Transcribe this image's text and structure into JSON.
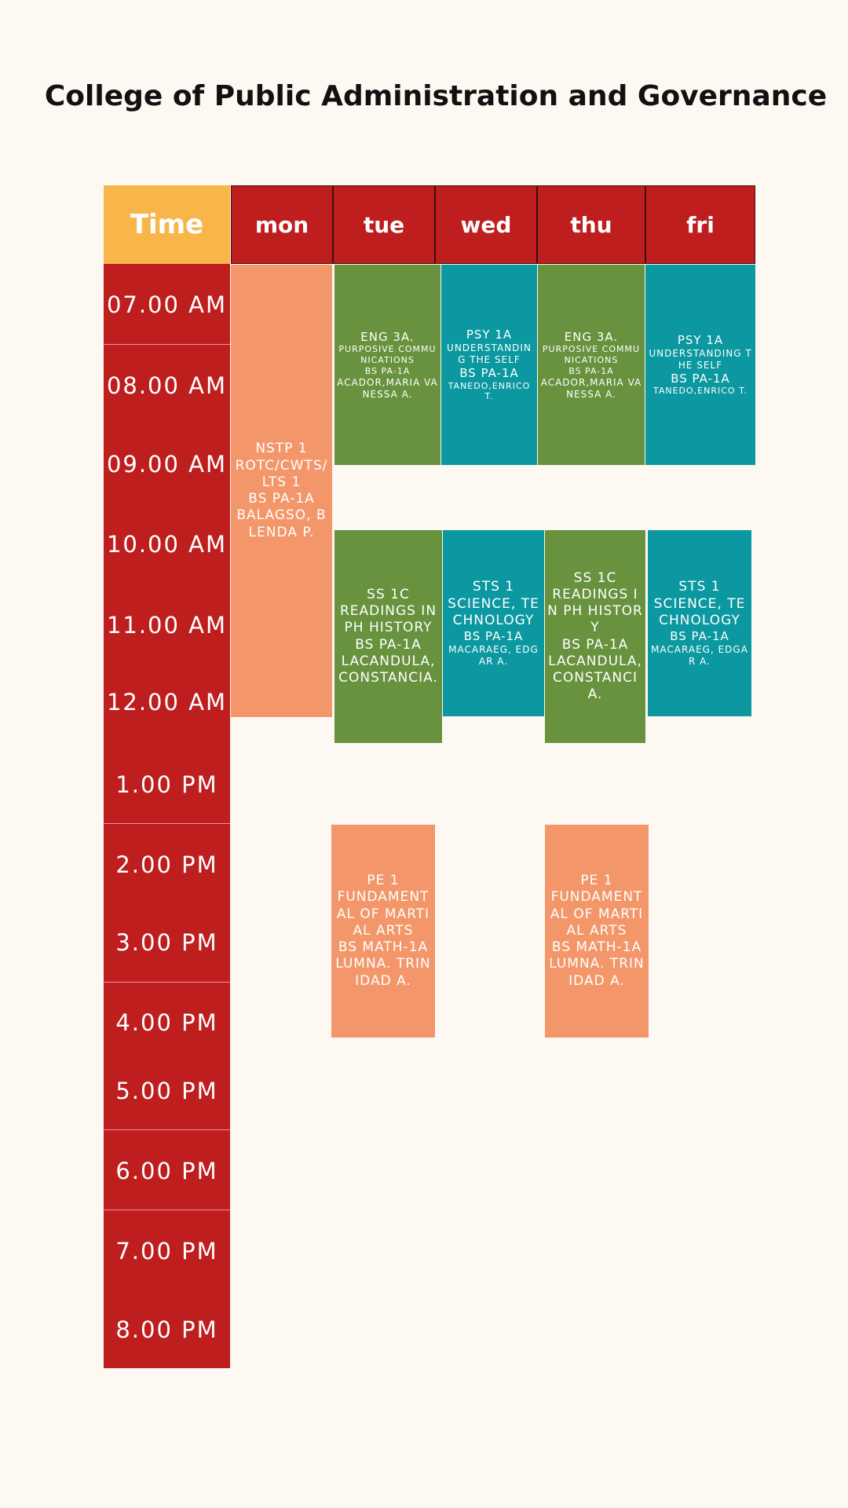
{
  "title": "College of Public Administration and Governance",
  "colors": {
    "background": "#fdf8f1",
    "time_header": "#f8b64a",
    "red": "#bf1e1e",
    "green": "#68923e",
    "teal": "#0b98a0",
    "salmon": "#f3976b"
  },
  "header": {
    "time": "Time",
    "days": [
      "mon",
      "tue",
      "wed",
      "thu",
      "fri"
    ]
  },
  "times": [
    "07.00 AM",
    "08.00 AM",
    "09.00 AM",
    "10.00 AM",
    "11.00 AM",
    "12.00 AM",
    "1.00 PM",
    "2.00 PM",
    "3.00 PM",
    "4.00 PM",
    "5.00 PM",
    "6.00 PM",
    "7.00 PM",
    "8.00 PM"
  ],
  "classes": {
    "mon_nstp": {
      "code": "NSTP 1",
      "title": "ROTC/CWTS/LTS 1",
      "section": "BS PA-1A",
      "instructor": "BALAGSO, BLENDA P."
    },
    "tue_eng": {
      "code": "ENG 3A.",
      "title": "PURPOSIVE COMMUNICATIONS",
      "section": "BS PA-1A",
      "instructor": "ACADOR,MARIA VANESSA A."
    },
    "wed_psy": {
      "code": "PSY 1A",
      "title": "UNDERSTANDING THE SELF",
      "section": "BS PA-1A",
      "instructor": "TANEDO,ENRICO T."
    },
    "thu_eng": {
      "code": "ENG 3A.",
      "title": "PURPOSIVE COMMUNICATIONS",
      "section": "BS PA-1A",
      "instructor": "ACADOR,MARIA VANESSA A."
    },
    "fri_psy": {
      "code": "PSY 1A",
      "title": "UNDERSTANDING THE SELF",
      "section": "BS PA-1A",
      "instructor": "TANEDO,ENRICO T."
    },
    "tue_ss": {
      "code": "SS 1C",
      "title": "READINGS IN PH HISTORY",
      "section": "BS PA-1A",
      "instructor": "LACANDULA,CONSTANCIA."
    },
    "wed_sts": {
      "code": "STS 1",
      "title": "SCIENCE, TECHNOLOGY",
      "section": "BS PA-1A",
      "instructor": "MACARAEG, EDGAR A."
    },
    "thu_ss": {
      "code": "SS 1C",
      "title": "READINGS IN PH HISTORY",
      "section": "BS PA-1A",
      "instructor": "LACANDULA,CONSTANCIA."
    },
    "fri_sts": {
      "code": "STS 1",
      "title": "SCIENCE, TECHNOLOGY",
      "section": "BS PA-1A",
      "instructor": "MACARAEG, EDGAR A."
    },
    "tue_pe": {
      "code": "PE 1",
      "title": "FUNDAMENTAL OF MARTIAL ARTS",
      "section": "BS MATH-1A",
      "instructor": "LUMNA. TRINIDAD A."
    },
    "thu_pe": {
      "code": "PE 1",
      "title": "FUNDAMENTAL OF MARTIAL ARTS",
      "section": "BS MATH-1A",
      "instructor": "LUMNA. TRINIDAD A."
    }
  }
}
